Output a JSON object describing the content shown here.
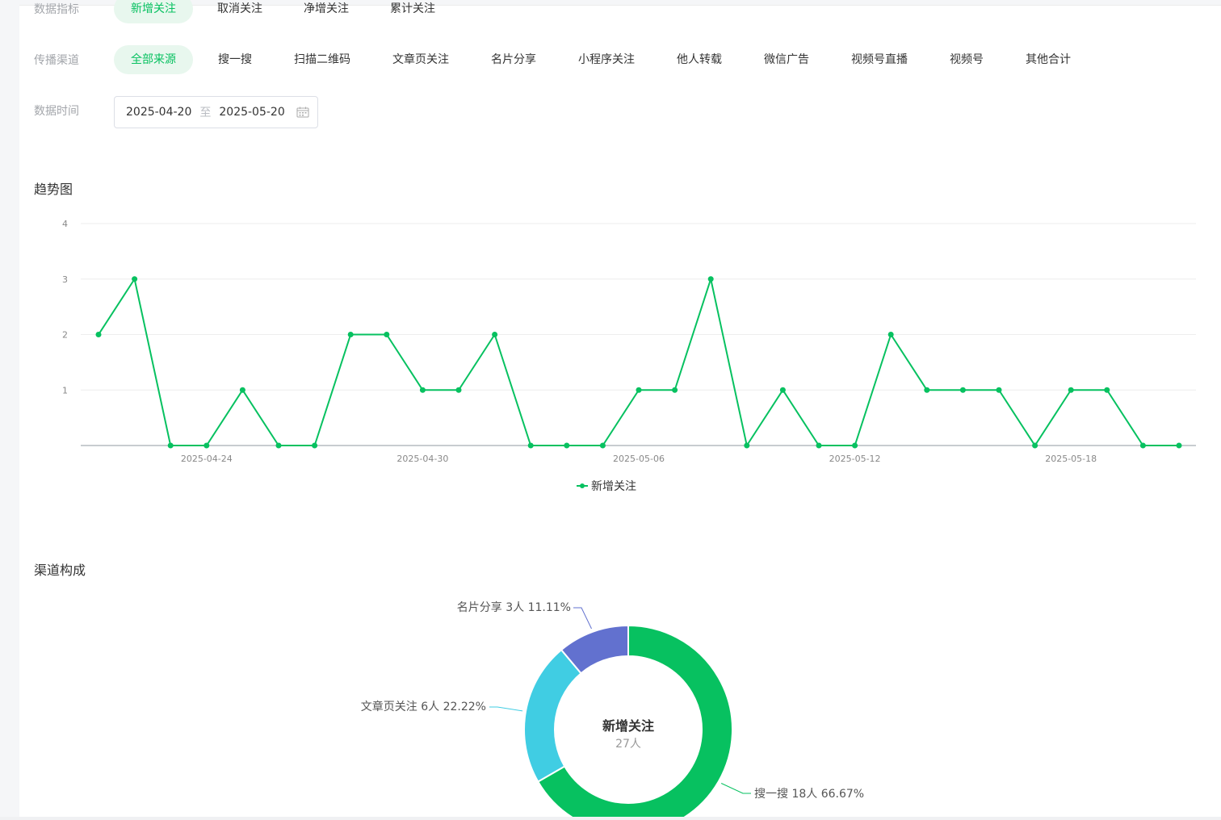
{
  "filters": {
    "metric": {
      "label": "数据指标",
      "options": [
        "新增关注",
        "取消关注",
        "净增关注",
        "累计关注"
      ],
      "selected": 0
    },
    "channel": {
      "label": "传播渠道",
      "options": [
        "全部来源",
        "搜一搜",
        "扫描二维码",
        "文章页关注",
        "名片分享",
        "小程序关注",
        "他人转载",
        "微信广告",
        "视频号直播",
        "视频号",
        "其他合计"
      ],
      "selected": 0
    },
    "date": {
      "label": "数据时间",
      "start": "2025-04-20",
      "separator": "至",
      "end": "2025-05-20"
    }
  },
  "trend": {
    "title": "趋势图",
    "legend": "新增关注"
  },
  "composition": {
    "title": "渠道构成",
    "center_title": "新增关注",
    "center_sub": "27人"
  },
  "colors": {
    "accent": "#07c160",
    "accent_bg": "#e8f7ee",
    "slice_search": "#07c160",
    "slice_article": "#40cde3",
    "slice_card": "#6271cf"
  },
  "chart_data": [
    {
      "type": "line",
      "title": "",
      "x": [
        "2025-04-21",
        "2025-04-22",
        "2025-04-23",
        "2025-04-24",
        "2025-04-25",
        "2025-04-26",
        "2025-04-27",
        "2025-04-28",
        "2025-04-29",
        "2025-04-30",
        "2025-05-01",
        "2025-05-02",
        "2025-05-03",
        "2025-05-04",
        "2025-05-05",
        "2025-05-06",
        "2025-05-07",
        "2025-05-08",
        "2025-05-09",
        "2025-05-10",
        "2025-05-11",
        "2025-05-12",
        "2025-05-13",
        "2025-05-14",
        "2025-05-15",
        "2025-05-16",
        "2025-05-17",
        "2025-05-18",
        "2025-05-19",
        "2025-05-20",
        "2025-05-21"
      ],
      "x_ticks": [
        "2025-04-24",
        "2025-04-30",
        "2025-05-06",
        "2025-05-12",
        "2025-05-18"
      ],
      "series": [
        {
          "name": "新增关注",
          "values": [
            2,
            3,
            0,
            0,
            1,
            0,
            0,
            2,
            2,
            1,
            1,
            2,
            0,
            0,
            0,
            1,
            1,
            3,
            0,
            1,
            0,
            0,
            2,
            1,
            1,
            1,
            0,
            1,
            1,
            0,
            0
          ]
        }
      ],
      "y_ticks": [
        1,
        2,
        3,
        4
      ],
      "ylim": [
        0,
        4
      ],
      "grid": true,
      "legend": "bottom-center"
    },
    {
      "type": "pie",
      "slices": [
        {
          "label": "搜一搜 18人 66.67%",
          "value": 18,
          "color": "#07c160"
        },
        {
          "label": "文章页关注 6人 22.22%",
          "value": 6,
          "color": "#40cde3"
        },
        {
          "label": "名片分享 3人 11.11%",
          "value": 3,
          "color": "#6271cf"
        }
      ],
      "donut": true,
      "center_text": "新增关注",
      "center_sub": "27人"
    }
  ]
}
